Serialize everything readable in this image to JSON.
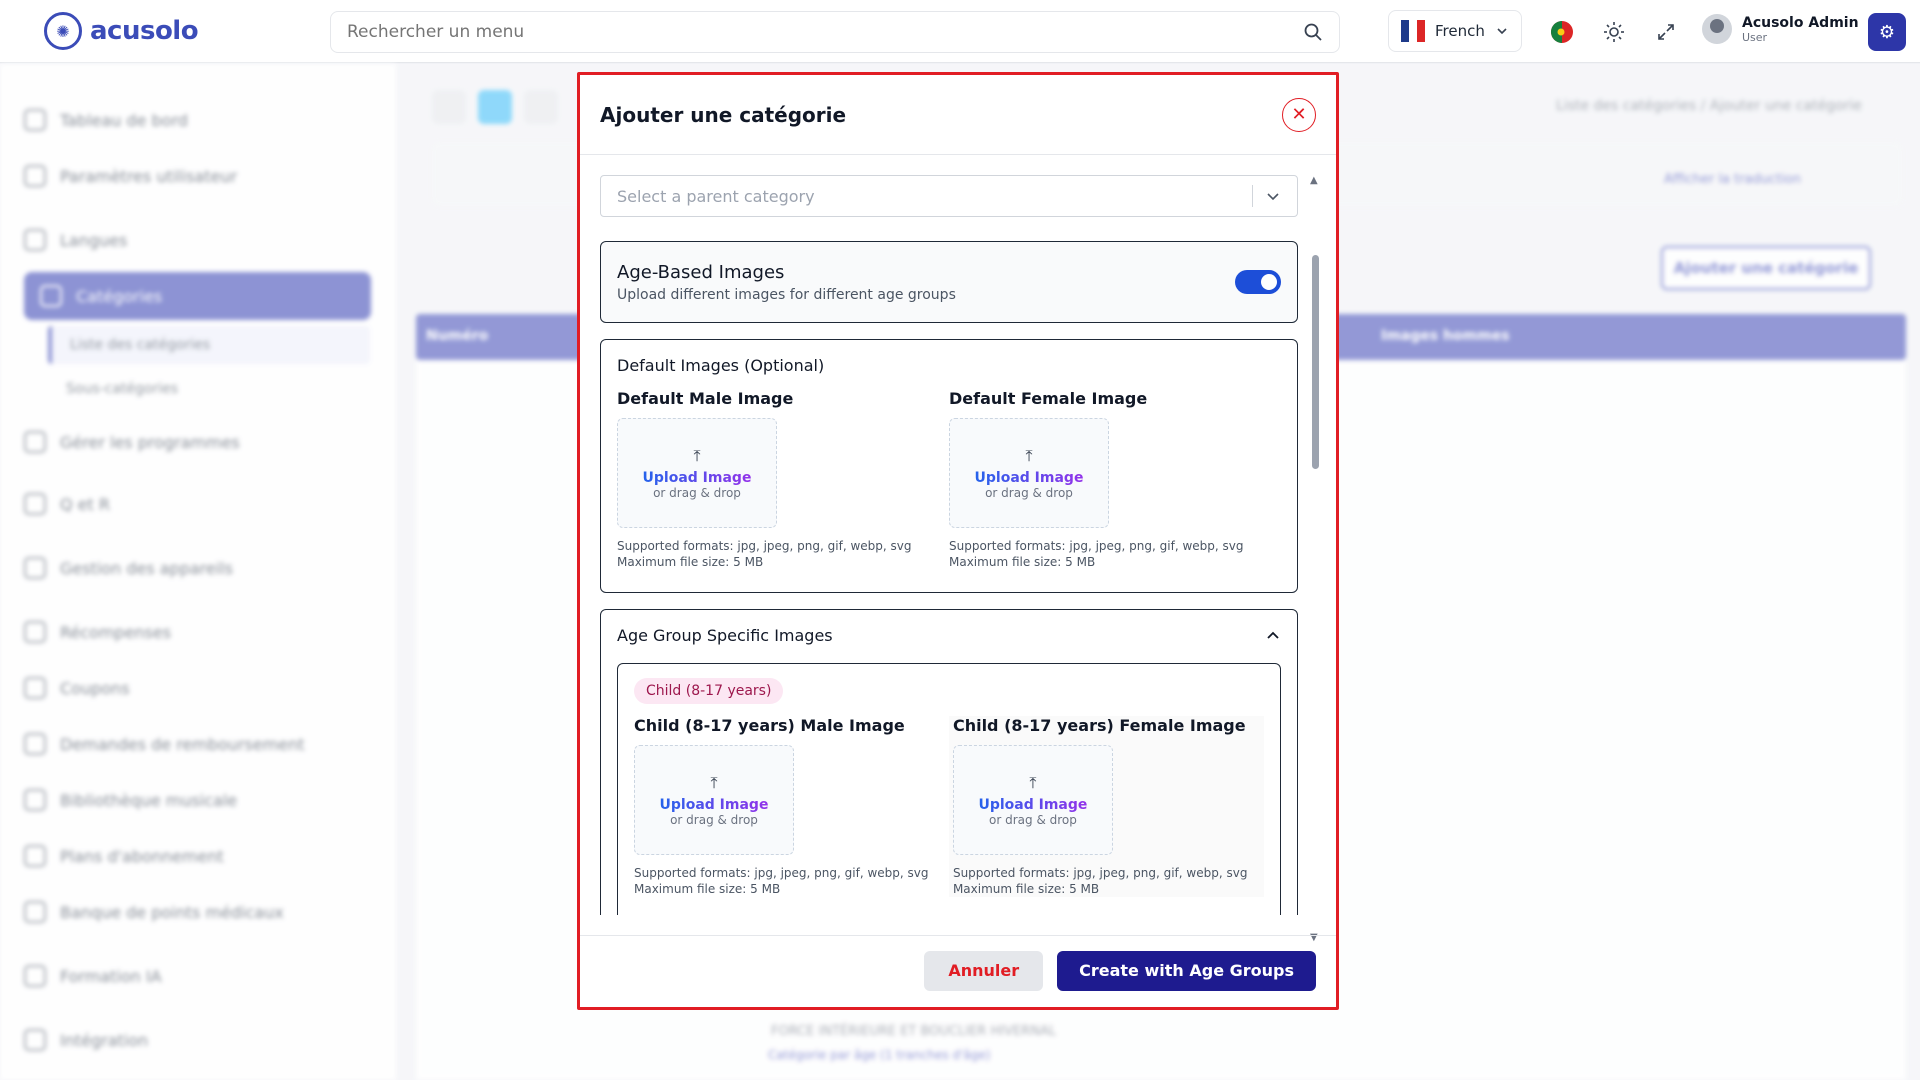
{
  "app": {
    "logo_text": "acusolo"
  },
  "search": {
    "placeholder": "Rechercher un menu"
  },
  "language": {
    "label": "French"
  },
  "user": {
    "name": "Acusolo Admin",
    "role": "User"
  },
  "sidebar": {
    "items": [
      {
        "label": "Tableau de bord"
      },
      {
        "label": "Paramètres utilisateur"
      },
      {
        "label": "Langues"
      },
      {
        "label": "Catégories"
      },
      {
        "label": "Gérer les programmes"
      },
      {
        "label": "Q et R"
      },
      {
        "label": "Gestion des appareils"
      },
      {
        "label": "Récompenses"
      },
      {
        "label": "Coupons"
      },
      {
        "label": "Demandes de remboursement"
      },
      {
        "label": "Bibliothèque musicale"
      },
      {
        "label": "Plans d'abonnement"
      },
      {
        "label": "Banque de points médicaux"
      },
      {
        "label": "Formation IA"
      },
      {
        "label": "Intégration"
      }
    ],
    "subitems": [
      {
        "label": "Liste des catégories"
      },
      {
        "label": "Sous-catégories"
      }
    ]
  },
  "background": {
    "breadcrumb": "Liste des catégories / Ajouter une catégorie",
    "add_button": "Ajouter une catégorie",
    "col_number": "Numéro",
    "col_images_men": "Images hommes",
    "translate_label": "Afficher la traduction",
    "row_title": "FORCE INTÉRIEURE ET BOUCLIER HIVERNAL",
    "row_sub": "Catégorie par âge (1 tranches d'âge)"
  },
  "modal": {
    "title": "Ajouter une catégorie",
    "parent_placeholder": "Select a parent category",
    "age_based": {
      "title": "Age-Based Images",
      "subtitle": "Upload different images for different age groups",
      "enabled": true
    },
    "default_section": {
      "title": "Default Images (Optional)",
      "male_label": "Default Male Image",
      "female_label": "Default Female Image"
    },
    "upload": {
      "main": "Upload Image",
      "sub": "or drag & drop",
      "formats": "Supported formats: jpg, jpeg, png, gif, webp, svg",
      "max": "Maximum file size: 5 MB"
    },
    "age_group_section": {
      "title": "Age Group Specific Images",
      "badge": "Child (8-17 years)",
      "male_label": "Child (8-17 years) Male Image",
      "female_label": "Child (8-17 years) Female Image"
    },
    "cancel": "Annuler",
    "create": "Create with Age Groups"
  },
  "colors": {
    "accent": "#2d36a8",
    "danger": "#e11d24",
    "primary_dark": "#1e1b8f"
  }
}
